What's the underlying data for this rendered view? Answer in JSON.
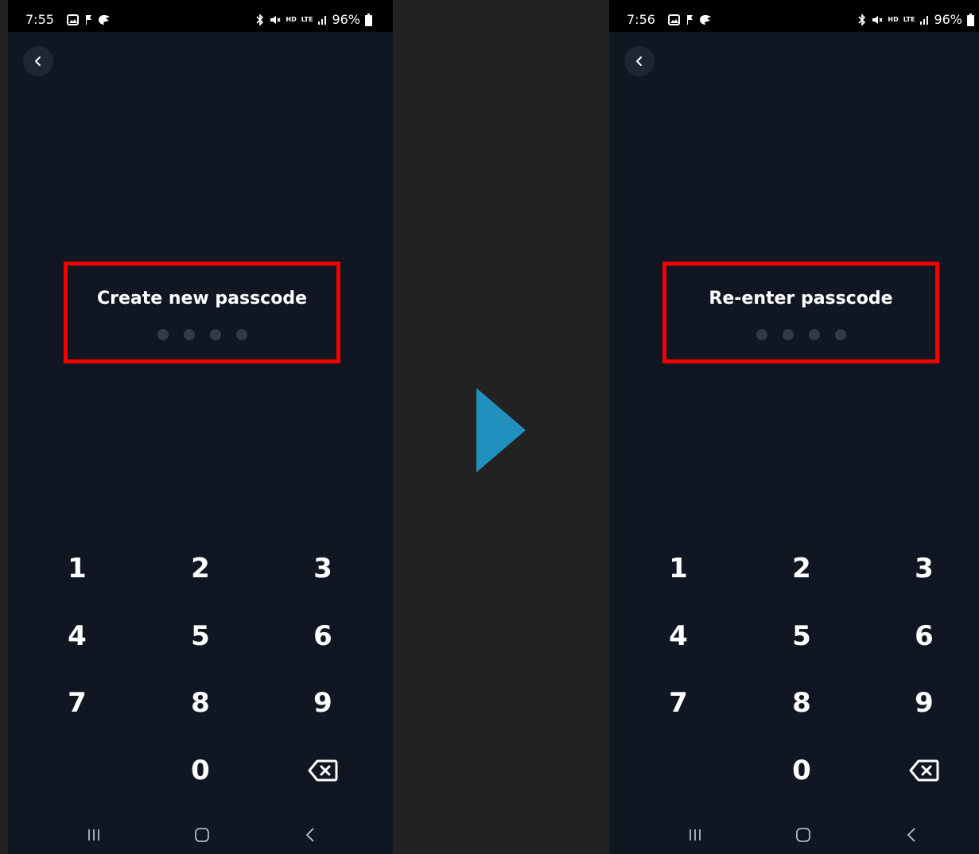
{
  "left_screen": {
    "status_time": "7:55",
    "battery_percent": "96%",
    "signal_label": "HD",
    "network_label": "LTE",
    "prompt_title": "Create new passcode",
    "passcode_length": 4,
    "passcode_filled": 0,
    "keys": [
      "1",
      "2",
      "3",
      "4",
      "5",
      "6",
      "7",
      "8",
      "9",
      "0"
    ],
    "highlight_color": "#f40000"
  },
  "right_screen": {
    "status_time": "7:56",
    "battery_percent": "96%",
    "signal_label": "HD",
    "network_label": "LTE",
    "prompt_title": "Re-enter passcode",
    "passcode_length": 4,
    "passcode_filled": 0,
    "keys": [
      "1",
      "2",
      "3",
      "4",
      "5",
      "6",
      "7",
      "8",
      "9",
      "0"
    ],
    "highlight_color": "#f40000"
  },
  "colors": {
    "app_background": "#111722",
    "canvas_background": "#222222",
    "status_bar": "#000000",
    "dot_empty": "#333a47",
    "arrow": "#2290bf"
  },
  "icons": [
    "back-chevron-icon",
    "backspace-icon",
    "recent-apps-icon",
    "home-icon",
    "nav-back-icon",
    "next-arrow-icon"
  ]
}
